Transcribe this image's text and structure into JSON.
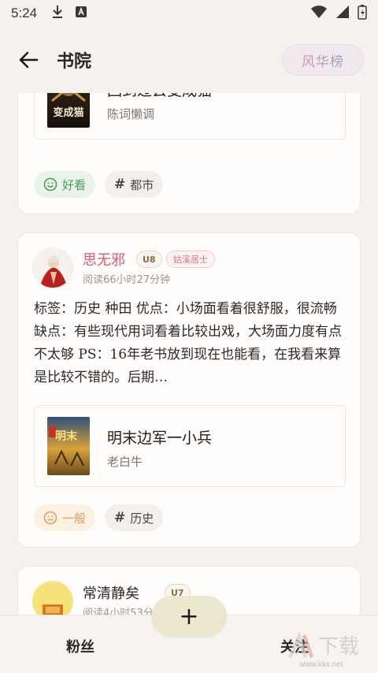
{
  "status_bar": {
    "time": "5:24"
  },
  "app_bar": {
    "title": "书院",
    "rank_button": "风华榜"
  },
  "cards": [
    {
      "book": {
        "title": "回到过去变成猫",
        "author": "陈词懒调",
        "cover_text": "变成猫"
      },
      "tags": [
        "好看",
        "都市"
      ]
    },
    {
      "user": {
        "name": "思无邪",
        "level": "U8",
        "title_badge": "姑溪居士",
        "read_time": "阅读66小时27分钟"
      },
      "review": "标签：历史 种田 优点：小场面看着很舒服，很流畅缺点：有些现代用词看着比较出戏，大场面力度有点不太够 PS：16年老书放到现在也能看，在我看来算是比较不错的。后期…",
      "book": {
        "title": "明末边军一小兵",
        "author": "老白牛",
        "cover_text": "明末"
      },
      "tags": [
        "一般",
        "历史"
      ]
    },
    {
      "user": {
        "name": "常清静矣",
        "level": "U7",
        "read_time": "阅读4小时53分"
      }
    }
  ],
  "bottom_nav": {
    "left": "粉丝",
    "right": "关注",
    "fab": "+"
  },
  "watermark": {
    "text": "下载",
    "url": "www.kkx.net"
  },
  "colors": {
    "good": "#4f9a5d",
    "ok": "#dba25c",
    "pink_name": "#d45a7d"
  }
}
